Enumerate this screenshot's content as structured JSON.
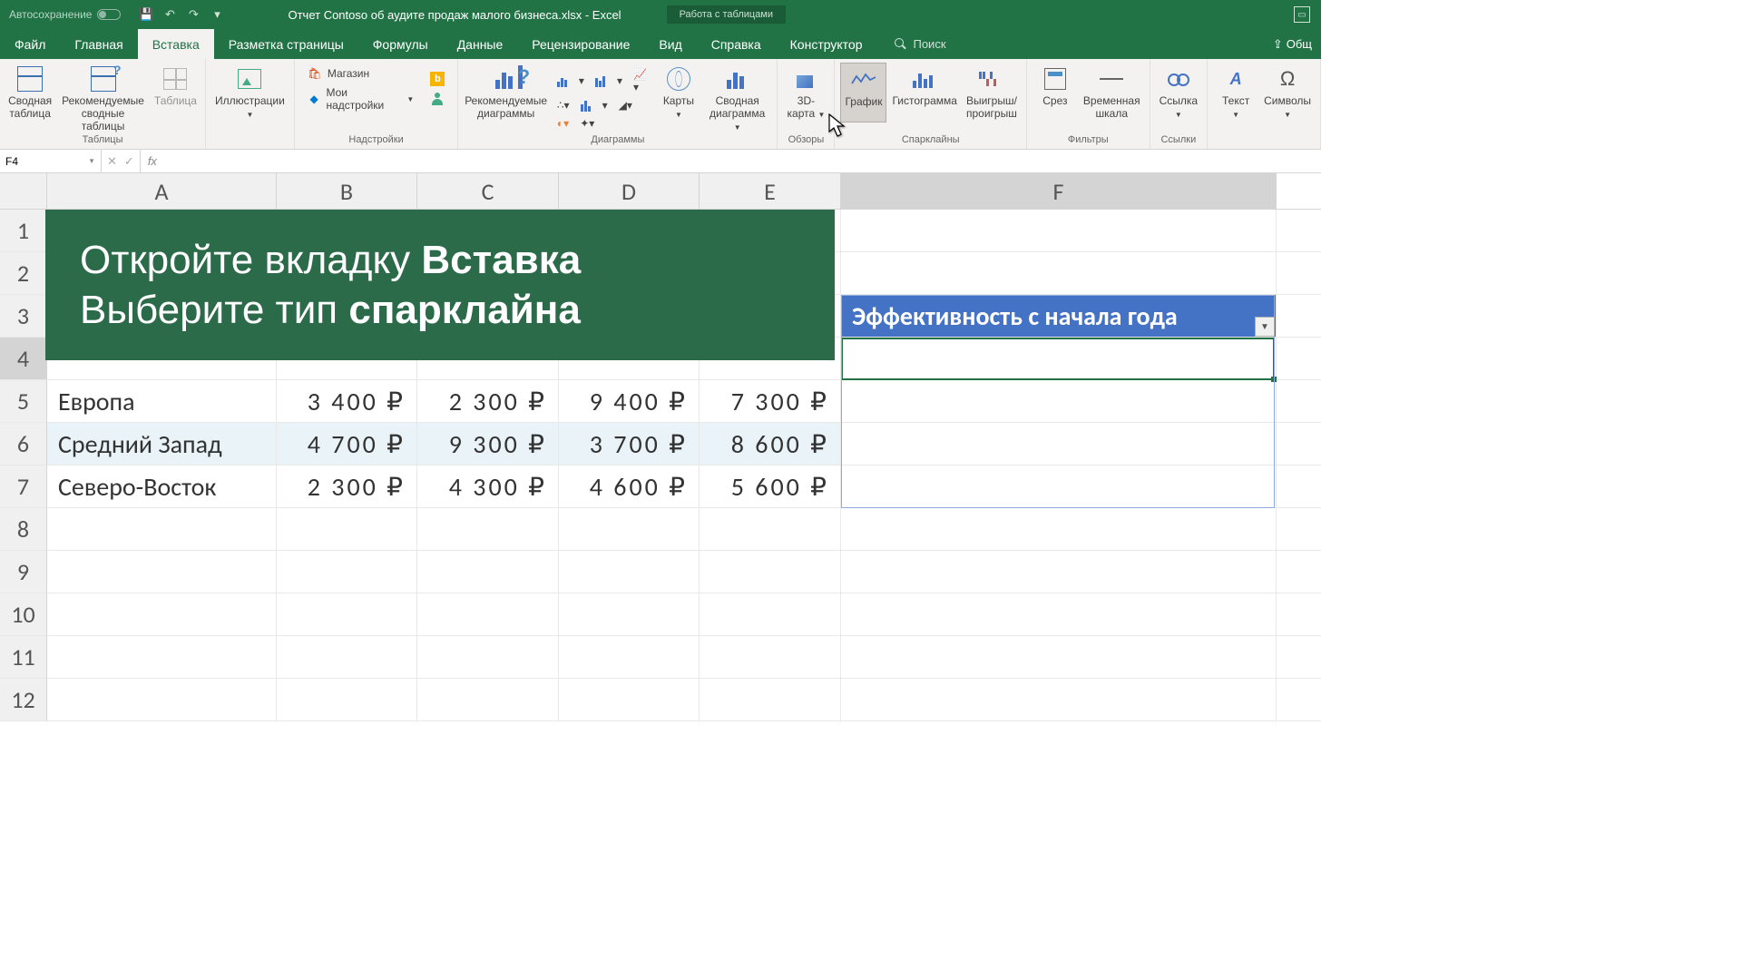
{
  "titlebar": {
    "autosave": "Автосохранение",
    "doc_title": "Отчет Contoso об аудите продаж малого бизнеса.xlsx  -  Excel",
    "table_tools": "Работа с таблицами"
  },
  "tabs": {
    "file": "Файл",
    "home": "Главная",
    "insert": "Вставка",
    "layout": "Разметка страницы",
    "formulas": "Формулы",
    "data": "Данные",
    "review": "Рецензирование",
    "view": "Вид",
    "help": "Справка",
    "design": "Конструктор",
    "search": "Поиск",
    "share": "Общ"
  },
  "ribbon": {
    "tables": {
      "pivot": "Сводная\nтаблица",
      "rec_pivot": "Рекомендуемые\nсводные таблицы",
      "table": "Таблица",
      "group": "Таблицы"
    },
    "illustrations": {
      "btn": "Иллюстрации",
      "group": ""
    },
    "addins": {
      "store": "Магазин",
      "my": "Мои надстройки",
      "group": "Надстройки"
    },
    "charts": {
      "rec": "Рекомендуемые\nдиаграммы",
      "maps": "Карты",
      "pivot_chart": "Сводная\nдиаграмма",
      "group": "Диаграммы"
    },
    "tours": {
      "map3d": "3D-\nкарта",
      "group": "Обзоры"
    },
    "sparklines": {
      "line": "График",
      "column": "Гистограмма",
      "winloss": "Выигрыш/\nпроигрыш",
      "group": "Спарклайны"
    },
    "filters": {
      "slicer": "Срез",
      "timeline": "Временная\nшкала",
      "group": "Фильтры"
    },
    "links": {
      "link": "Ссылка",
      "group": "Ссылки"
    },
    "text": {
      "text": "Текст",
      "symbols": "Символы"
    }
  },
  "formula_bar": {
    "name_box": "F4",
    "fx": "fx"
  },
  "sheet": {
    "cols": [
      "A",
      "B",
      "C",
      "D",
      "E",
      "F"
    ],
    "header_f": "Эффективность с начала года",
    "rows": [
      {
        "label": "Европа",
        "b": "3  400  ₽",
        "c": "2  300  ₽",
        "d": "9  400  ₽",
        "e": "7  300  ₽"
      },
      {
        "label": "Средний Запад",
        "b": "4  700  ₽",
        "c": "9  300  ₽",
        "d": "3  700  ₽",
        "e": "8  600  ₽"
      },
      {
        "label": "Северо-Восток",
        "b": "2  300  ₽",
        "c": "4  300  ₽",
        "d": "4  600  ₽",
        "e": "5  600  ₽"
      }
    ],
    "row_nums": [
      "1",
      "2",
      "3",
      "4",
      "5",
      "6",
      "7",
      "8",
      "9",
      "10",
      "11",
      "12"
    ]
  },
  "tutorial": {
    "l1a": "Откройте вкладку ",
    "l1b": "Вставка",
    "l2a": "Выберите тип ",
    "l2b": "спарклайна"
  }
}
